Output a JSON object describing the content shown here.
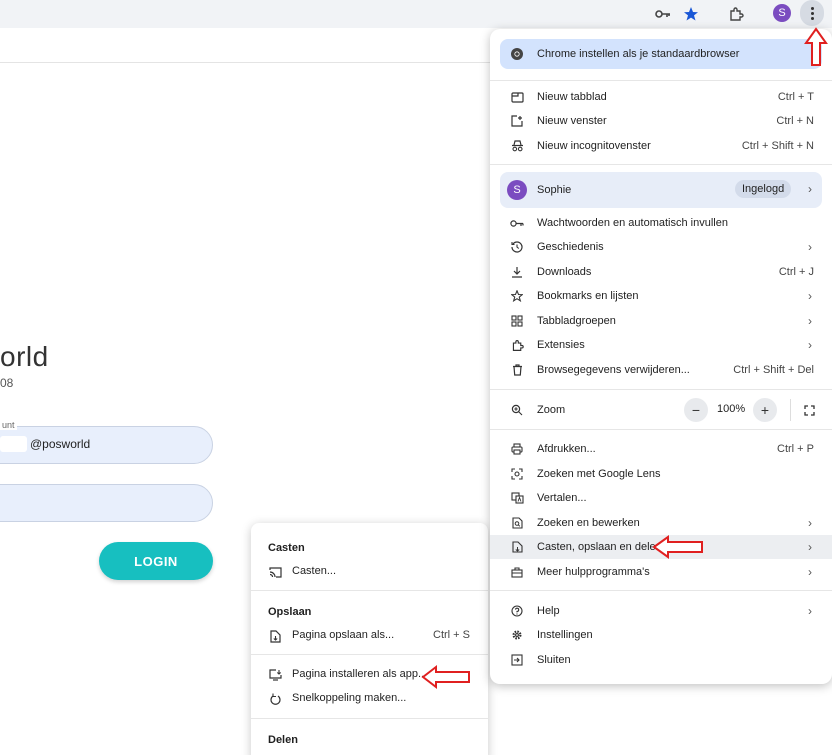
{
  "toolbar": {
    "avatar_letter": "S"
  },
  "page": {
    "brand_title": "orld",
    "brand_sub": "08",
    "account_label": "unt",
    "account_value": "@posworld",
    "login_label": "LOGIN"
  },
  "menu": {
    "default_browser": "Chrome instellen als je standaardbrowser",
    "new_tab": {
      "label": "Nieuw tabblad",
      "shortcut": "Ctrl + T"
    },
    "new_window": {
      "label": "Nieuw venster",
      "shortcut": "Ctrl + N"
    },
    "incognito": {
      "label": "Nieuw incognitovenster",
      "shortcut": "Ctrl + Shift + N"
    },
    "profile": {
      "avatar_letter": "S",
      "name": "Sophie",
      "status": "Ingelogd"
    },
    "passwords": {
      "label": "Wachtwoorden en automatisch invullen"
    },
    "history": {
      "label": "Geschiedenis"
    },
    "downloads": {
      "label": "Downloads",
      "shortcut": "Ctrl + J"
    },
    "bookmarks": {
      "label": "Bookmarks en lijsten"
    },
    "tabgroups": {
      "label": "Tabbladgroepen"
    },
    "extensions": {
      "label": "Extensies"
    },
    "clear_data": {
      "label": "Browsegegevens verwijderen...",
      "shortcut": "Ctrl + Shift + Del"
    },
    "zoom": {
      "label": "Zoom",
      "value": "100%",
      "minus": "−",
      "plus": "+"
    },
    "print": {
      "label": "Afdrukken...",
      "shortcut": "Ctrl + P"
    },
    "lens": {
      "label": "Zoeken met Google Lens"
    },
    "translate": {
      "label": "Vertalen..."
    },
    "find_edit": {
      "label": "Zoeken en bewerken"
    },
    "cast_save_share": {
      "label": "Casten, opslaan en delen"
    },
    "more_tools": {
      "label": "Meer hulpprogramma's"
    },
    "help": {
      "label": "Help"
    },
    "settings": {
      "label": "Instellingen"
    },
    "exit": {
      "label": "Sluiten"
    }
  },
  "submenu": {
    "cast_heading": "Casten",
    "cast_item": "Casten...",
    "save_heading": "Opslaan",
    "save_page": {
      "label": "Pagina opslaan als...",
      "shortcut": "Ctrl + S"
    },
    "install_app": "Pagina installeren als app...",
    "create_shortcut": "Snelkoppeling maken...",
    "share_heading": "Delen"
  },
  "colors": {
    "accent_blue": "#d3e3fd",
    "login_teal": "#17bfc0",
    "avatar_purple": "#7b4cc0",
    "annotation_red": "#e02020"
  }
}
